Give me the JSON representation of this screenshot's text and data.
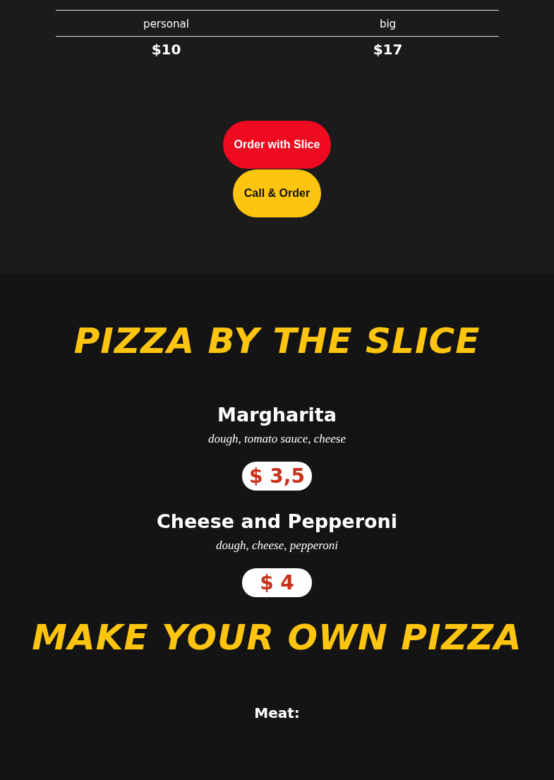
{
  "size_table": {
    "columns": [
      {
        "size": "personal",
        "price": "$10"
      },
      {
        "size": "big",
        "price": "$17"
      }
    ]
  },
  "buttons": [
    {
      "label": "Order with Slice",
      "kind": "order"
    },
    {
      "label": "Call & Order",
      "kind": "call"
    }
  ],
  "slice_section": {
    "title": "PIZZA BY THE SLICE",
    "items": [
      {
        "name": "Margharita",
        "ingredients": "dough, tomato sauce, cheese",
        "price": "$ 3,5"
      },
      {
        "name": "Cheese and Pepperoni",
        "ingredients": "dough, cheese, pepperoni",
        "price": "$ 4"
      }
    ]
  },
  "own_section": {
    "title": "MAKE YOUR OWN PIZZA",
    "category": "Meat:"
  }
}
